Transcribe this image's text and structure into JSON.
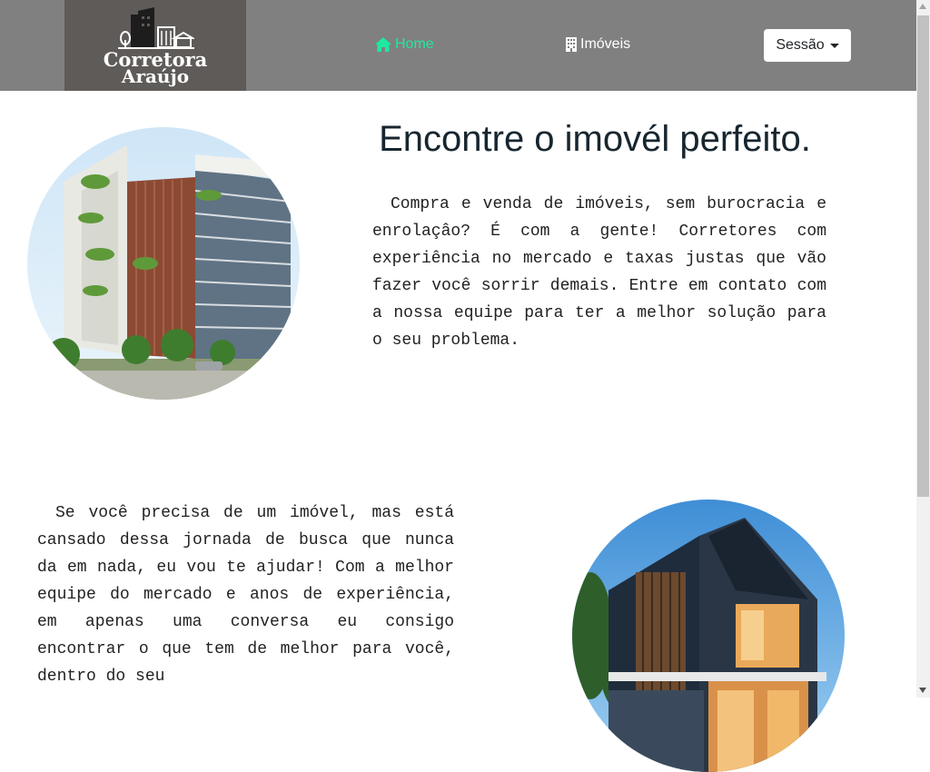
{
  "brand": {
    "line1": "Corretora",
    "line2": "Araújo"
  },
  "nav": {
    "home_label": "Home",
    "imoveis_label": "Imóveis",
    "session_label": "Sessão",
    "active_color": "#1de9a0"
  },
  "hero": {
    "headline": "Encontre o imovél perfeito.",
    "paragraph": "Compra e venda de imóveis, sem burocracia e enrolaçâo? É com a gente! Corretores com experiência no mercado e taxas justas que vão fazer você sorrir demais. Entre em contato com a nossa equipe para ter a melhor solução para o seu problema."
  },
  "section2": {
    "paragraph": "Se você precisa de um imóvel, mas está cansado dessa jornada de busca que nunca da em nada, eu vou te ajudar! Com a melhor equipe do mercado e anos de experiência, em apenas uma conversa eu consigo encontrar o que tem de melhor para você, dentro do seu"
  },
  "colors": {
    "navbar": "#808080",
    "logo_bg": "#5f5b59",
    "headline": "#17262f"
  },
  "icons": {
    "home": "home-icon",
    "building": "building-icon",
    "caret": "caret-down-icon"
  }
}
